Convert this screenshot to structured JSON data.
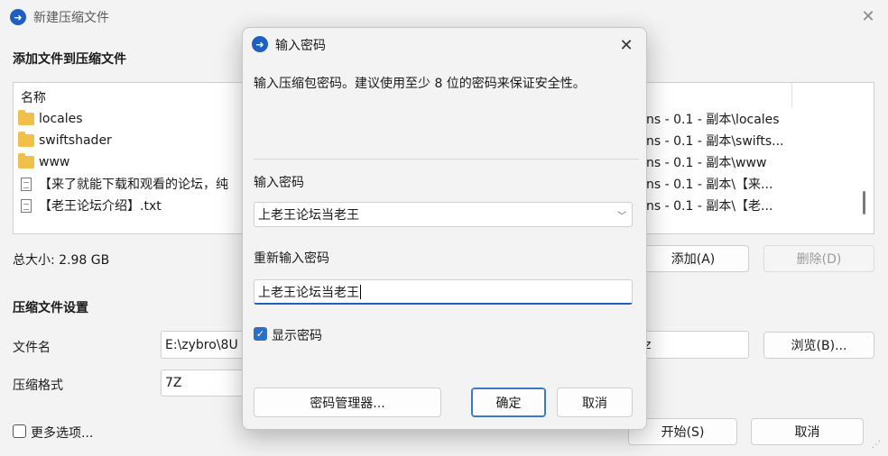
{
  "main_window": {
    "title": "新建压缩文件",
    "section_add": "添加文件到压缩文件",
    "list_header_name": "名称",
    "list_items": [
      {
        "name": "locales",
        "type": "folder",
        "path": "ns - 0.1 - 副本\\locales"
      },
      {
        "name": "swiftshader",
        "type": "folder",
        "path": "ns - 0.1 - 副本\\swifts..."
      },
      {
        "name": "www",
        "type": "folder",
        "path": "ns - 0.1 - 副本\\www"
      },
      {
        "name": "【来了就能下载和观看的论坛，纯",
        "type": "file",
        "path": "ns - 0.1 - 副本\\【来..."
      },
      {
        "name": "【老王论坛介绍】.txt",
        "type": "file",
        "path": "ns - 0.1 - 副本\\【老..."
      }
    ],
    "total_size": "总大小: 2.98 GB",
    "add_button": "添加(A)",
    "delete_button": "删除(D)",
    "section_settings": "压缩文件设置",
    "filename_label": "文件名",
    "filename_value": "E:\\zybro\\8U",
    "filename_suffix": "z",
    "browse_button": "浏览(B)...",
    "format_label": "压缩格式",
    "format_value": "7Z",
    "more_options": "更多选项...",
    "start_button": "开始(S)",
    "cancel_button": "取消"
  },
  "dialog": {
    "title": "输入密码",
    "description": "输入压缩包密码。建议使用至少 8 位的密码来保证安全性。",
    "password_label": "输入密码",
    "password_value": "上老王论坛当老王",
    "confirm_label": "重新输入密码",
    "confirm_value": "上老王论坛当老王",
    "show_password": "显示密码",
    "show_password_checked": true,
    "manager_button": "密码管理器...",
    "ok_button": "确定",
    "cancel_button": "取消"
  },
  "colors": {
    "accent": "#1f5fbf",
    "checkbox": "#2a6fc9",
    "folder": "#f0c04a"
  }
}
